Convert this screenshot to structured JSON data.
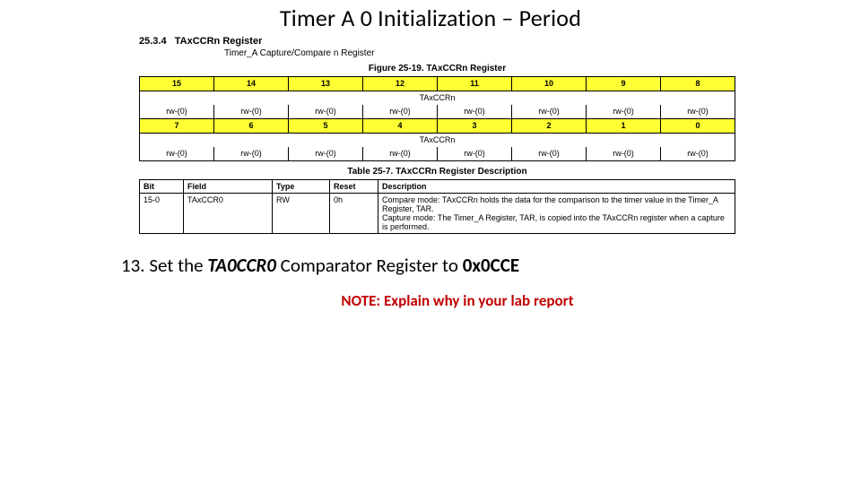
{
  "title": "Timer A 0 Initialization – Period",
  "section": {
    "number": "25.3.4",
    "name": "TAxCCRn Register",
    "sub": "Timer_A Capture/Compare n Register"
  },
  "figure_caption": "Figure 25-19. TAxCCRn Register",
  "bit_table": {
    "high_bits": [
      "15",
      "14",
      "13",
      "12",
      "11",
      "10",
      "9",
      "8"
    ],
    "high_label": "TAxCCRn",
    "high_rw": [
      "rw-(0)",
      "rw-(0)",
      "rw-(0)",
      "rw-(0)",
      "rw-(0)",
      "rw-(0)",
      "rw-(0)",
      "rw-(0)"
    ],
    "low_bits": [
      "7",
      "6",
      "5",
      "4",
      "3",
      "2",
      "1",
      "0"
    ],
    "low_label": "TAxCCRn",
    "low_rw": [
      "rw-(0)",
      "rw-(0)",
      "rw-(0)",
      "rw-(0)",
      "rw-(0)",
      "rw-(0)",
      "rw-(0)",
      "rw-(0)"
    ]
  },
  "table_caption": "Table 25-7. TAxCCRn Register Description",
  "desc_table": {
    "headers": {
      "bit": "Bit",
      "field": "Field",
      "type": "Type",
      "reset": "Reset",
      "desc": "Description"
    },
    "row": {
      "bit": "15-0",
      "field": "TAxCCR0",
      "type": "RW",
      "reset": "0h",
      "desc_line1": "Compare mode: TAxCCRn holds the data for the comparison to the timer value in the Timer_A Register, TAR.",
      "desc_line2": "Capture mode: The Timer_A Register, TAR, is copied into the TAxCCRn register when a capture is performed."
    }
  },
  "step": {
    "prefix": "13. Set the ",
    "reg": "TA0CCR0",
    "mid": "  Comparator Register to ",
    "val": "0x0CCE"
  },
  "note": "NOTE: Explain why in your lab report"
}
